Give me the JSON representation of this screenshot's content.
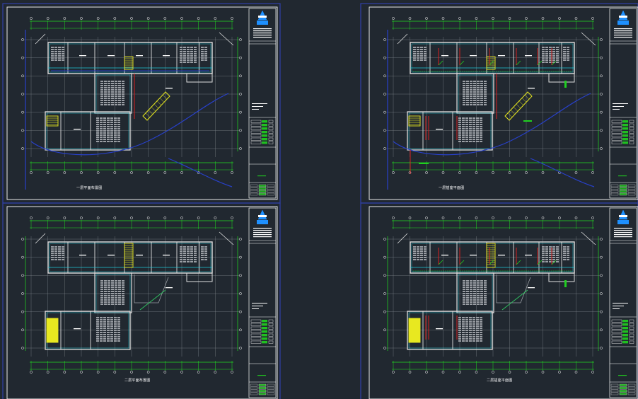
{
  "viewport": {
    "background": "#212830"
  },
  "colors": {
    "grid": "#8a8f96",
    "axis": "#22dd22",
    "wall": "#e0e0e0",
    "cyan": "#20c8d8",
    "blue": "#2840c8",
    "red": "#d82020",
    "yellow": "#e8e820",
    "white": "#ffffff",
    "gray": "#9a9ea4",
    "sheet_border": "#ffffff",
    "outer_frame": "#3040a8"
  },
  "sheets": [
    {
      "id": "top-left",
      "label": "一层平面布置图",
      "variant": "base-first-floor"
    },
    {
      "id": "top-right",
      "label": "一层插座平面图",
      "variant": "electrical-first-floor"
    },
    {
      "id": "bottom-left",
      "label": "二层平面布置图",
      "variant": "base-second-floor"
    },
    {
      "id": "bottom-right",
      "label": "二层插座平面图",
      "variant": "electrical-second-floor"
    }
  ],
  "title_block": {
    "logo_icon": "company-logo-icon"
  }
}
